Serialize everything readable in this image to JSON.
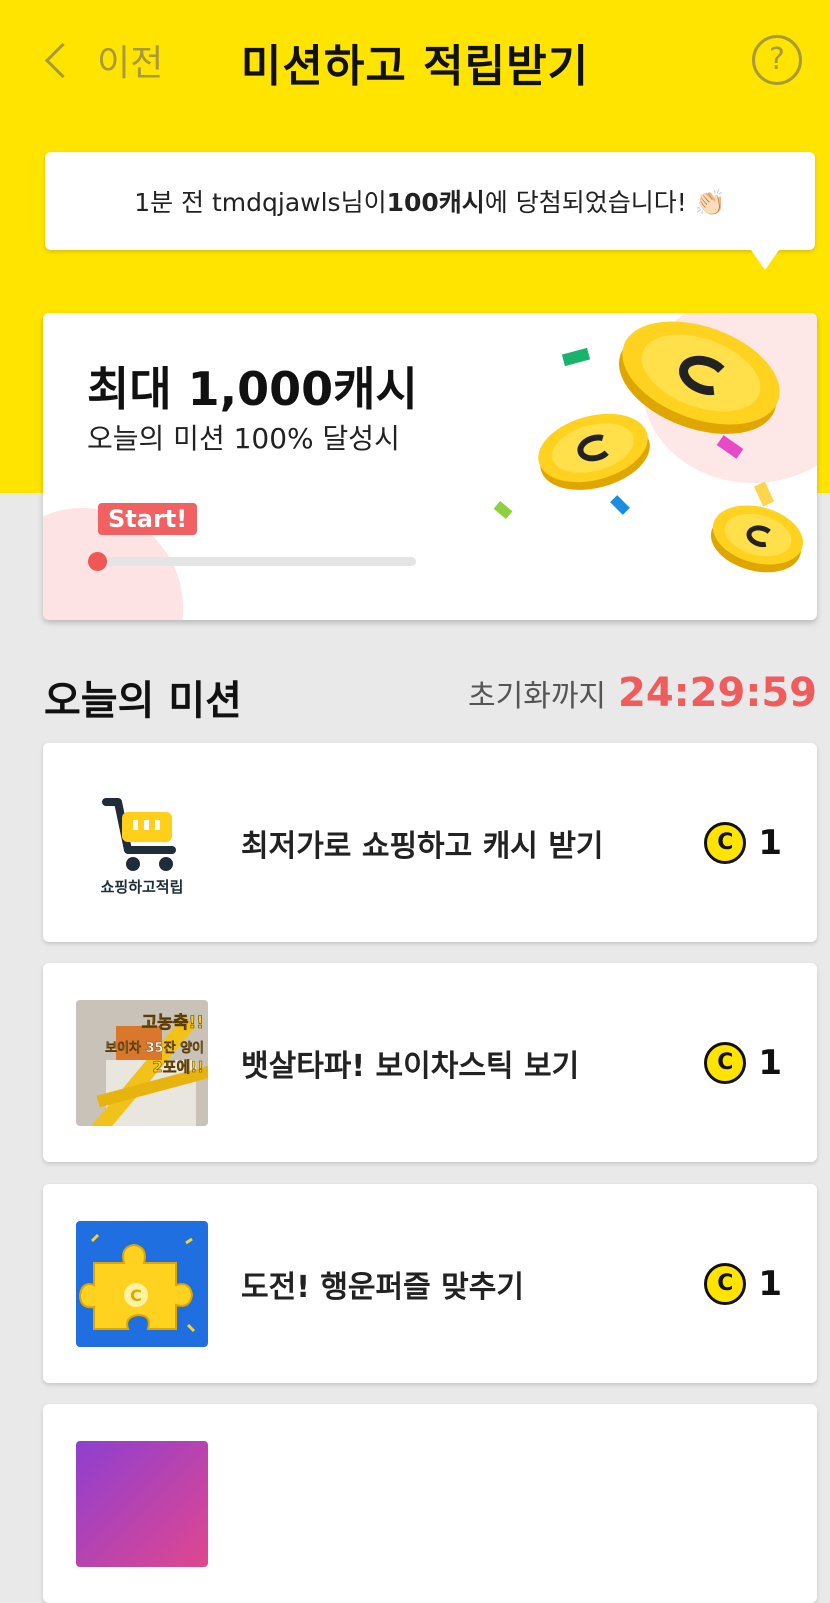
{
  "header": {
    "back_label": "이전",
    "title": "미션하고 적립받기",
    "help_icon": "?"
  },
  "notice": {
    "prefix": "1분 전 tmdqjawls님이 ",
    "amount": "100캐시",
    "suffix": "에 당첨되었습니다! 👏🏻"
  },
  "hero": {
    "headline": "최대 1,000캐시",
    "subtitle": "오늘의 미션 100% 달성시",
    "start_label": "Start!",
    "progress": 0
  },
  "missions_section": {
    "title": "오늘의 미션",
    "timer_label": "초기화까지",
    "timer_value": "24:29:59"
  },
  "missions": [
    {
      "label": "최저가로 쇼핑하고 캐시 받기",
      "thumb_text": "쇼핑하고적립",
      "reward": "1"
    },
    {
      "label": "뱃살타파! 보이차스틱 보기",
      "thumb_text": "고농축!! 보이차 35잔 양이 2포에!!",
      "reward": "1"
    },
    {
      "label": "도전! 행운퍼즐 맞추기",
      "reward": "1"
    }
  ],
  "coin_glyph": "C",
  "colors": {
    "brand_yellow": "#ffe400",
    "accent_red": "#f05b5b"
  }
}
